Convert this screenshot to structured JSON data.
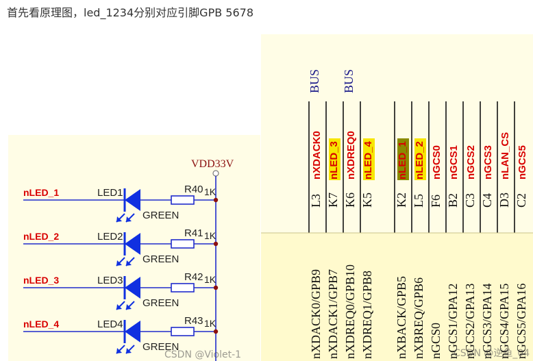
{
  "intro_text": "首先看原理图，led_1234分别对应引脚GPB 5678",
  "power": {
    "label": "VDD33V"
  },
  "leds": [
    {
      "net": "nLED_1",
      "ref": "LED1",
      "color": "GREEN",
      "resistor": "R40",
      "value": "1K"
    },
    {
      "net": "nLED_2",
      "ref": "LED2",
      "color": "GREEN",
      "resistor": "R41",
      "value": "1K"
    },
    {
      "net": "nLED_3",
      "ref": "LED3",
      "color": "GREEN",
      "resistor": "R42",
      "value": "1K"
    },
    {
      "net": "nLED_4",
      "ref": "LED4",
      "color": "GREEN",
      "resistor": "R43",
      "value": "1K"
    }
  ],
  "bus_labels": [
    "BUS",
    "BUS"
  ],
  "pins": [
    {
      "ball": "L3",
      "net": "nXDACK0",
      "func": "nXDACK0/GPB9",
      "highlight": "none"
    },
    {
      "ball": "K7",
      "net": "nLED_3",
      "func": "nXDACK1/GPB7",
      "highlight": "yellow"
    },
    {
      "ball": "K6",
      "net": "nXDREQ0",
      "func": "nXDREQ0/GPB10",
      "highlight": "none"
    },
    {
      "ball": "K5",
      "net": "nLED_4",
      "func": "nXDREQ1/GPB8",
      "highlight": "yellow"
    },
    {
      "ball": "K2",
      "net": "nLED_1",
      "func": "nXBACK/GPB5",
      "highlight": "olive"
    },
    {
      "ball": "L5",
      "net": "nLED_2",
      "func": "nXBREQ/GPB6",
      "highlight": "yellow"
    },
    {
      "ball": "F6",
      "net": "nGCS0",
      "func": "nGCS0",
      "highlight": "none"
    },
    {
      "ball": "B2",
      "net": "nGCS1",
      "func": "nGCS1/GPA12",
      "highlight": "none"
    },
    {
      "ball": "C3",
      "net": "nGCS2",
      "func": "nGCS2/GPA13",
      "highlight": "none"
    },
    {
      "ball": "C4",
      "net": "nGCS3",
      "func": "nGCS3/GPA14",
      "highlight": "none"
    },
    {
      "ball": "D3",
      "net": "nLAN_CS",
      "func": "nGCS4/GPA15",
      "highlight": "none"
    },
    {
      "ball": "C2",
      "net": "nGCS5",
      "func": "nGCS5/GPA16",
      "highlight": "none"
    }
  ],
  "watermarks": {
    "left": "CSDN @Violet-1",
    "right": "CSDN @逆鱼_04"
  },
  "colors": {
    "wire": "#1f2bcc",
    "led": "#1030e0",
    "net_label": "#d80000",
    "power_label": "#8b1010",
    "junction": "#8b1010",
    "highlight_yellow": "#f7e600",
    "highlight_olive": "#8a8a00"
  }
}
